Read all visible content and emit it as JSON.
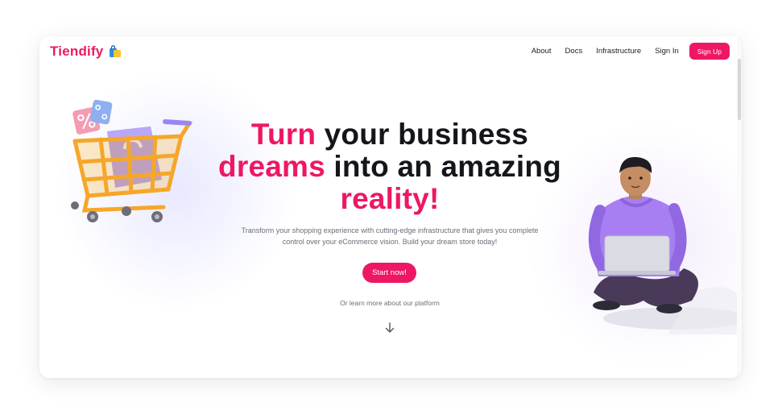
{
  "brand": {
    "name": "Tiendify",
    "logo_icon": "shopping-bag-icon",
    "accent": "#ee1765"
  },
  "nav": {
    "links": [
      "About",
      "Docs",
      "Infrastructure",
      "Sign In"
    ],
    "signup_label": "Sign Up"
  },
  "hero": {
    "headline": {
      "part1_accent": "Turn",
      "part2": " your business",
      "part3_accent": "dreams",
      "part4": " into an amazing",
      "part5_accent": "reality!"
    },
    "description": "Transform your shopping experience with cutting-edge infrastructure that gives you complete control over your eCommerce vision. Build your dream store today!",
    "cta_label": "Start now!",
    "learn_more": "Or learn more about our platform",
    "scroll_icon": "arrow-down-icon"
  },
  "illustrations": {
    "left": "shopping-cart-illustration",
    "right": "person-with-laptop-illustration"
  },
  "colors": {
    "text_dark": "#14161c",
    "muted": "#6b6e78",
    "cart_orange": "#f5a72a",
    "bag_purple": "#9b86f0",
    "hoodie_purple": "#a77ff2"
  }
}
